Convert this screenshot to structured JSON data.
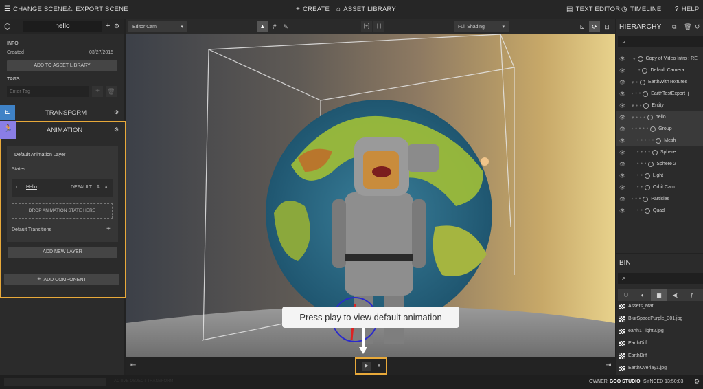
{
  "topbar": {
    "change_scene": "CHANGE SCENE",
    "export_scene": "EXPORT SCENE",
    "create": "CREATE",
    "asset_library": "ASSET LIBRARY",
    "text_editor": "TEXT EDITOR",
    "timeline": "TIMELINE",
    "help": "HELP"
  },
  "left_panel": {
    "entity_name": "hello",
    "info_header": "INFO",
    "created_label": "Created",
    "created_date": "03/27/2015",
    "add_to_library": "ADD TO ASSET LIBRARY",
    "tags_header": "TAGS",
    "tag_placeholder": "Enter Tag",
    "transform_label": "TRANSFORM",
    "animation_label": "ANIMATION",
    "layer_name": "Default Animation Layer",
    "states_label": "States",
    "state_name": "Hello",
    "state_default": "DEFAULT",
    "drop_zone": "DROP ANIMATION STATE HERE",
    "default_transitions": "Default Transitions",
    "add_layer": "ADD NEW LAYER",
    "add_component": "ADD COMPONENT"
  },
  "viewport_toolbar": {
    "camera_select": "Editor Cam",
    "shading_select": "Full Shading"
  },
  "tooltip": {
    "text": "Press play to view default animation"
  },
  "hierarchy": {
    "title": "HIERARCHY",
    "items": [
      {
        "label": "Copy of Video Intro : RE",
        "depth": 0
      },
      {
        "label": "Default Camera",
        "depth": 1
      },
      {
        "label": "EarthWithTextures",
        "depth": 1
      },
      {
        "label": "EarthTestExport_j",
        "depth": 2
      },
      {
        "label": "Entity",
        "depth": 1
      },
      {
        "label": "hello",
        "depth": 2
      },
      {
        "label": "Group",
        "depth": 3
      },
      {
        "label": "Mesh",
        "depth": 4
      },
      {
        "label": "Sphere",
        "depth": 3
      },
      {
        "label": "Sphere 2",
        "depth": 2
      },
      {
        "label": "Light",
        "depth": 1
      },
      {
        "label": "Orbit Cam",
        "depth": 1
      },
      {
        "label": "Particles",
        "depth": 1
      },
      {
        "label": "Quad",
        "depth": 1
      }
    ]
  },
  "bin": {
    "title": "BIN",
    "items": [
      "Assets_Mat",
      "BlurSpacePurple_301.jpg",
      "earth1_light2.jpg",
      "EarthDiff",
      "EarthDiff",
      "EarthOverlay1.jpg"
    ]
  },
  "status": {
    "owner_label": "OWNER",
    "owner_name": "GOO STUDIO",
    "synced": "SYNCED 13:50:03",
    "faded_text": "ACTIVE OBJECT TRANSFORM"
  }
}
